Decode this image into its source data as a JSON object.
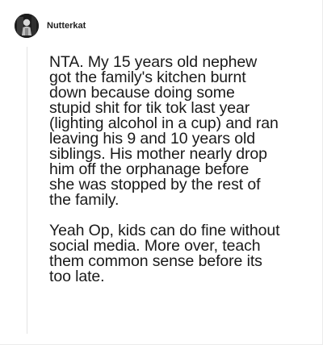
{
  "comment": {
    "author": "Nutterkat",
    "avatar_icon": "user-avatar-icon",
    "paragraphs": [
      "NTA. My 15 years old nephew\ngot the family's kitchen burnt\ndown because doing some\nstupid shit for tik tok last year\n(lighting alcohol in a cup) and ran\nleaving his 9 and 10 years old\nsiblings. His mother nearly drop\nhim off the orphanage before\nshe was stopped by the rest of\nthe family.",
      "Yeah Op, kids can do fine without\nsocial media. More over, teach\nthem common sense before its\ntoo late."
    ]
  }
}
